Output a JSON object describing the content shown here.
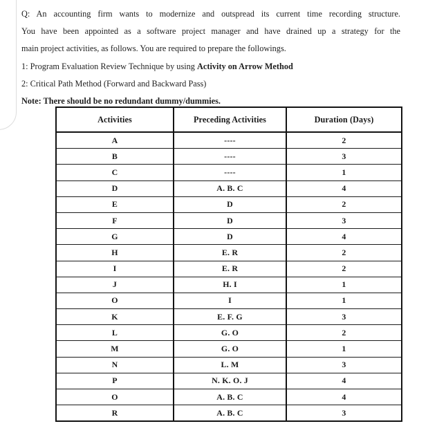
{
  "document": {
    "background_color": "#ffffff",
    "text_color": "#1f1f1f",
    "table_border_color": "#121212"
  },
  "question": {
    "line1": "Q: An accounting firm wants to modernize and outspread its current time recording structure.",
    "line2": "You have been appointed as a software project manager and have drained up a strategy for the",
    "line3": "main project activities, as follows. You are required to prepare the followings.",
    "line4_plain": "1: Program Evaluation Review Technique by using ",
    "line4_bold": "Activity on Arrow Method",
    "line5": "2: Critical Path Method (Forward and Backward Pass)",
    "line6_bold": "Note: There should be no redundant dummy/dummies."
  },
  "table": {
    "headers": [
      "Activities",
      "Preceding Activities",
      "Duration (Days)"
    ],
    "rows": [
      {
        "activity": "A",
        "preceding": "----",
        "duration": "2"
      },
      {
        "activity": "B",
        "preceding": "----",
        "duration": "3"
      },
      {
        "activity": "C",
        "preceding": "----",
        "duration": "1"
      },
      {
        "activity": "D",
        "preceding": "A. B. C",
        "duration": "4"
      },
      {
        "activity": "E",
        "preceding": "D",
        "duration": "2"
      },
      {
        "activity": "F",
        "preceding": "D",
        "duration": "3"
      },
      {
        "activity": "G",
        "preceding": "D",
        "duration": "4"
      },
      {
        "activity": "H",
        "preceding": "E. R",
        "duration": "2"
      },
      {
        "activity": "I",
        "preceding": "E. R",
        "duration": "2"
      },
      {
        "activity": "J",
        "preceding": "H. I",
        "duration": "1"
      },
      {
        "activity": "O",
        "preceding": "I",
        "duration": "1"
      },
      {
        "activity": "K",
        "preceding": "E. F. G",
        "duration": "3"
      },
      {
        "activity": "L",
        "preceding": "G. O",
        "duration": "2"
      },
      {
        "activity": "M",
        "preceding": "G. O",
        "duration": "1"
      },
      {
        "activity": "N",
        "preceding": "L. M",
        "duration": "3"
      },
      {
        "activity": "P",
        "preceding": "N. K. O. J",
        "duration": "4"
      },
      {
        "activity": "O",
        "preceding": "A. B. C",
        "duration": "4"
      },
      {
        "activity": "R",
        "preceding": "A. B. C",
        "duration": "3"
      }
    ]
  }
}
